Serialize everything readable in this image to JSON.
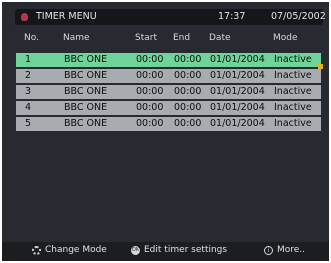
{
  "title_bar": {
    "title": "TIMER MENU",
    "time": "17:37",
    "date": "07/05/2002"
  },
  "table": {
    "headers": [
      "No.",
      "Name",
      "Start",
      "End",
      "Date",
      "Mode"
    ],
    "rows": [
      {
        "no": "1",
        "name": "BBC ONE",
        "start": "00:00",
        "end": "00:00",
        "date": "01/01/2004",
        "mode": "Inactive"
      },
      {
        "no": "2",
        "name": "BBC ONE",
        "start": "00:00",
        "end": "00:00",
        "date": "01/01/2004",
        "mode": "Inactive"
      },
      {
        "no": "3",
        "name": "BBC ONE",
        "start": "00:00",
        "end": "00:00",
        "date": "01/01/2004",
        "mode": "Inactive"
      },
      {
        "no": "4",
        "name": "BBC ONE",
        "start": "00:00",
        "end": "00:00",
        "date": "01/01/2004",
        "mode": "Inactive"
      },
      {
        "no": "5",
        "name": "BBC ONE",
        "start": "00:00",
        "end": "00:00",
        "date": "01/01/2004",
        "mode": "Inactive"
      }
    ],
    "selected_row": 1
  },
  "footer": {
    "change_mode_icon": "gear-icon",
    "change_mode_label": "Change Mode",
    "edit_icon": "ok-button-icon",
    "edit_label": "Edit timer settings",
    "more_icon": "info-icon",
    "more_label": "More.."
  },
  "colors": {
    "background": "#272a31",
    "row_normal": "#a8abaf",
    "row_selected": "#6ed49a",
    "title_icon": "#b23a48",
    "scroll_marker": "#e4b021"
  }
}
